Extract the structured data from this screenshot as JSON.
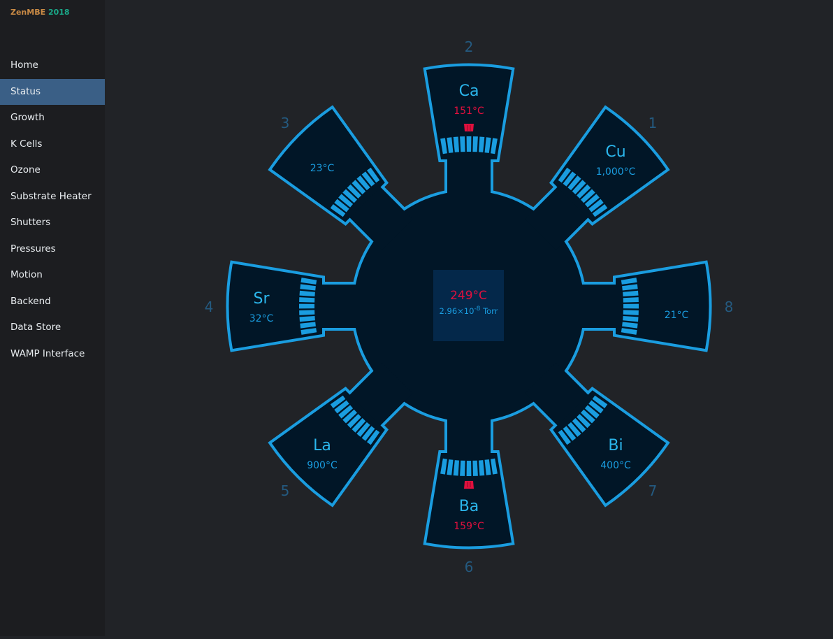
{
  "app": {
    "title_main": "ZenMBE",
    "title_year": "2018"
  },
  "sidebar": {
    "items": [
      {
        "label": "Home"
      },
      {
        "label": "Status",
        "active": true
      },
      {
        "label": "Growth"
      },
      {
        "label": "K Cells"
      },
      {
        "label": "Ozone"
      },
      {
        "label": "Substrate Heater"
      },
      {
        "label": "Shutters"
      },
      {
        "label": "Pressures"
      },
      {
        "label": "Motion"
      },
      {
        "label": "Backend"
      },
      {
        "label": "Data Store"
      },
      {
        "label": "WAMP Interface"
      }
    ]
  },
  "chamber": {
    "substrate_temp": "249°C",
    "pressure_mantissa": "2.96×10",
    "pressure_exponent": "-8",
    "pressure_unit": "Torr"
  },
  "ports": [
    {
      "number": "1",
      "element": "Cu",
      "temp": "1,000°C",
      "shutter_open": false,
      "hot": false
    },
    {
      "number": "2",
      "element": "Ca",
      "temp": "151°C",
      "shutter_open": true,
      "hot": true
    },
    {
      "number": "3",
      "element": "",
      "temp": "23°C",
      "shutter_open": false,
      "hot": false
    },
    {
      "number": "4",
      "element": "Sr",
      "temp": "32°C",
      "shutter_open": false,
      "hot": false
    },
    {
      "number": "5",
      "element": "La",
      "temp": "900°C",
      "shutter_open": false,
      "hot": false
    },
    {
      "number": "6",
      "element": "Ba",
      "temp": "159°C",
      "shutter_open": true,
      "hot": true
    },
    {
      "number": "7",
      "element": "Bi",
      "temp": "400°C",
      "shutter_open": false,
      "hot": false
    },
    {
      "number": "8",
      "element": "",
      "temp": "21°C",
      "shutter_open": false,
      "hot": false
    }
  ],
  "colors": {
    "outline": "#1a9de0",
    "fill": "#011627",
    "label": "#2bb6ec",
    "temp": "#1a9de0",
    "hot": "#e0103e",
    "port_number": "#245a80",
    "center_box": "#04284a",
    "selected_nav": "#3a5f86"
  }
}
